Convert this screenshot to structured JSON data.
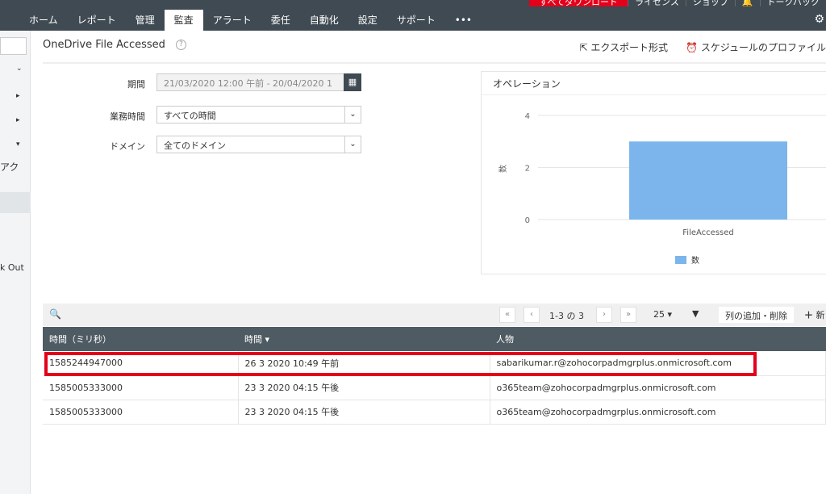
{
  "top": {
    "download": "すべてダウンロード",
    "license": "ライセンス",
    "shop": "ショップ",
    "talkback": "トークバック"
  },
  "nav": [
    "ホーム",
    "レポート",
    "管理",
    "監査",
    "アラート",
    "委任",
    "自動化",
    "設定",
    "サポート",
    "•••"
  ],
  "side": {
    "partial1": "アク",
    "partial2": "k Out"
  },
  "page": {
    "title": "OneDrive File Accessed",
    "help": "?",
    "export": "エクスポート形式",
    "schedule": "スケジュールのプロファイル"
  },
  "filters": {
    "period_label": "期間",
    "period_value": "21/03/2020 12:00 午前 - 20/04/2020 1",
    "hours_label": "業務時間",
    "hours_value": "すべての時間",
    "domain_label": "ドメイン",
    "domain_value": "全てのドメイン"
  },
  "chart_data": {
    "type": "bar",
    "title": "オペレーション",
    "categories": [
      "FileAccessed"
    ],
    "series": [
      {
        "name": "数",
        "values": [
          3
        ]
      }
    ],
    "ylabel": "数",
    "yticks": [
      "0",
      "2",
      "4"
    ],
    "ylim": [
      0,
      4
    ],
    "color": "#7cb5ec",
    "legend": "bottom"
  },
  "toolbar": {
    "page_info": "1-3 の 3",
    "page_size": "25",
    "add_remove": "列の追加・削除",
    "new": "新"
  },
  "table": {
    "headers": [
      "時間（ミリ秒）",
      "時間",
      "人物"
    ],
    "rows": [
      [
        "1585244947000",
        "26 3 2020 10:49 午前",
        "sabarikumar.r@zohocorpadmgrplus.onmicrosoft.com"
      ],
      [
        "1585005333000",
        "23 3 2020 04:15 午後",
        "o365team@zohocorpadmgrplus.onmicrosoft.com"
      ],
      [
        "1585005333000",
        "23 3 2020 04:15 午後",
        "o365team@zohocorpadmgrplus.onmicrosoft.com"
      ]
    ]
  }
}
